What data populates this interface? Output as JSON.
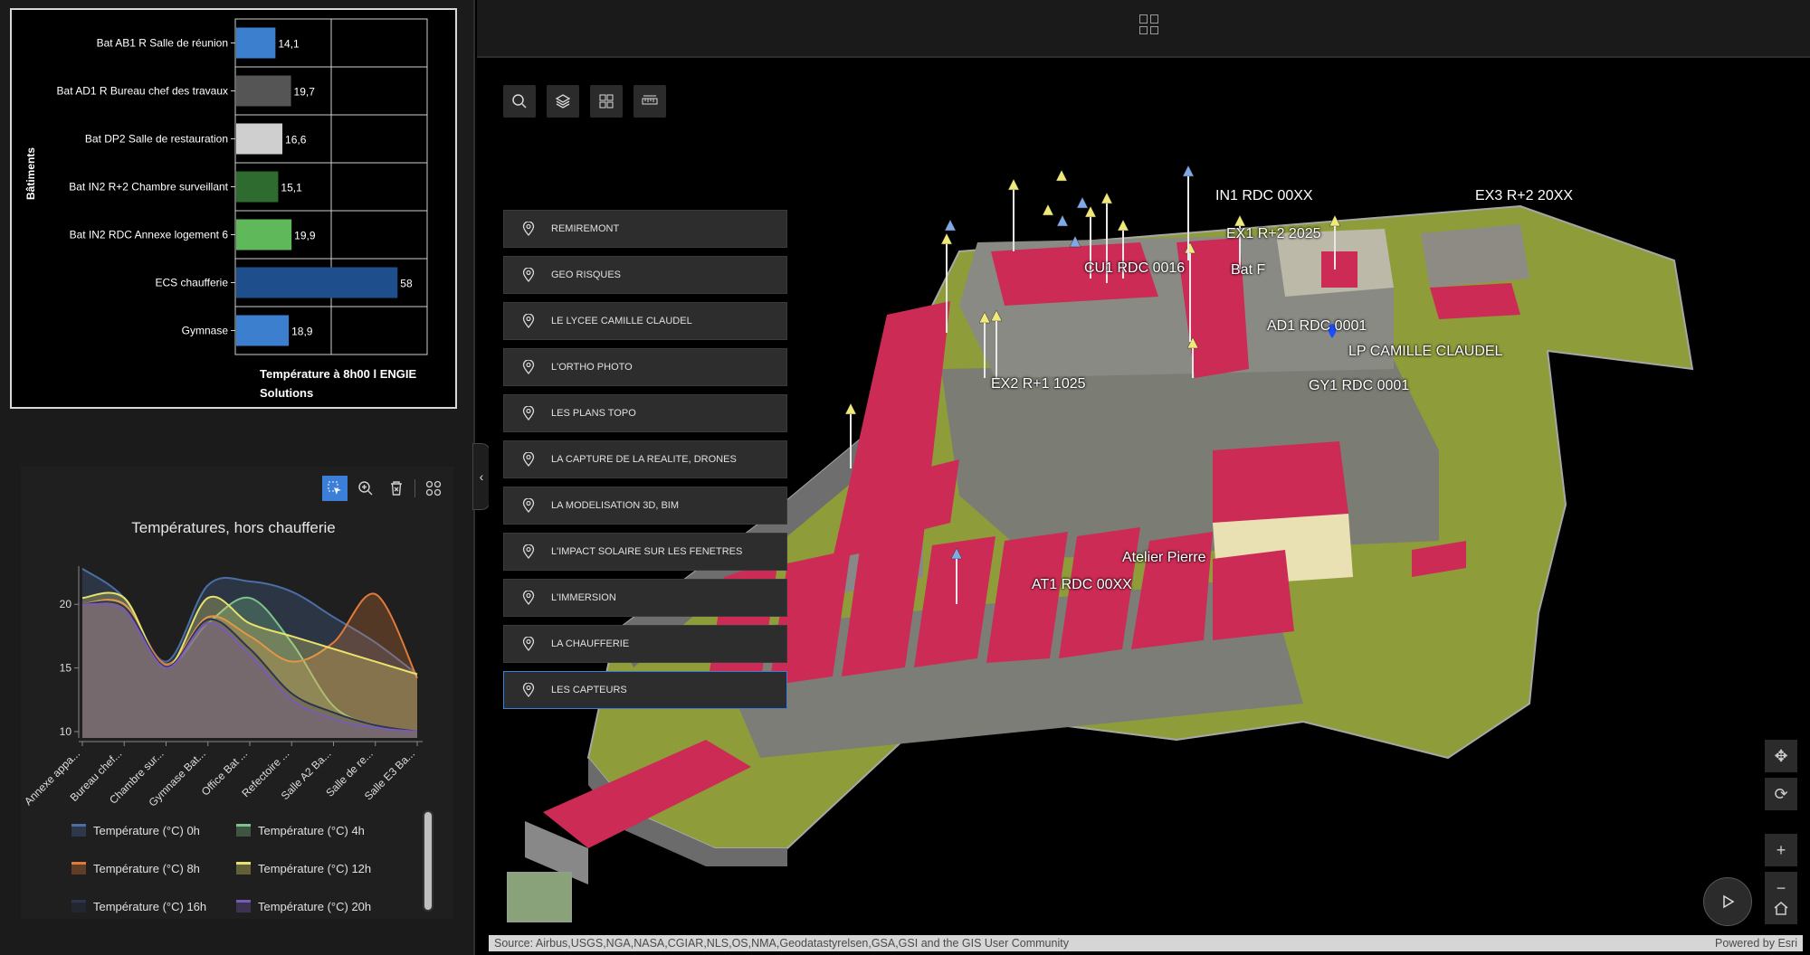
{
  "bar_chart": {
    "chart_data": {
      "type": "bar",
      "orientation": "horizontal",
      "categories": [
        "Bat AB1 R Salle de réunion",
        "Bat AD1 R Bureau chef des travaux",
        "Bat DP2 Salle de restauration",
        "Bat IN2 R+2 Chambre surveillant",
        "Bat IN2 RDC Annexe logement 6",
        "ECS chaufferie",
        "Gymnase"
      ],
      "values": [
        14.1,
        19.7,
        16.6,
        15.1,
        19.9,
        58,
        18.9
      ],
      "value_labels": [
        "14,1",
        "19,7",
        "16,6",
        "15,1",
        "19,9",
        "58",
        "18,9"
      ],
      "colors": [
        "#3d7fcf",
        "#555555",
        "#cfcfcf",
        "#2e6b2e",
        "#5fb85a",
        "#1f4e8c",
        "#3d7fcf"
      ],
      "xlabel": "Température à 8h00 l ENGIE Solutions",
      "ylabel": "Bâtiments",
      "xlim": [
        0,
        100
      ],
      "grid": true
    }
  },
  "line_chart": {
    "title": "Températures, hors chaufferie",
    "toolbar": [
      "select-icon",
      "zoom-icon",
      "clear-selection-icon",
      "grid-icon"
    ],
    "chart_data": {
      "type": "area",
      "categories": [
        "Annexe appa...",
        "Bureau chef...",
        "Chambre sur...",
        "Gymnase Bat...",
        "Office Bat ...",
        "Refectoire ...",
        "Salle A2 Ba...",
        "Salle de re...",
        "Salle E3 Ba..."
      ],
      "ylim": [
        9.5,
        23
      ],
      "yticks": [
        10,
        15,
        20
      ],
      "series": [
        {
          "name": "Température (°C) 0h",
          "color": "#4a6fa5",
          "values": [
            22.8,
            20.5,
            15.5,
            21.5,
            21.8,
            21.0,
            19.0,
            17.0,
            14.5
          ]
        },
        {
          "name": "Température (°C) 4h",
          "color": "#7fc28a",
          "values": [
            20.0,
            20.0,
            15.2,
            18.5,
            20.5,
            17.0,
            12.0,
            10.5,
            10.0
          ]
        },
        {
          "name": "Température (°C) 8h",
          "color": "#e07b39",
          "values": [
            20.0,
            20.0,
            15.3,
            19.0,
            17.5,
            15.5,
            17.0,
            20.8,
            14.2
          ]
        },
        {
          "name": "Température (°C) 12h",
          "color": "#e8e26a",
          "values": [
            20.5,
            20.5,
            15.0,
            20.5,
            18.5,
            17.5,
            16.5,
            15.5,
            14.5
          ]
        },
        {
          "name": "Température (°C) 16h",
          "color": "#2b3550",
          "values": [
            20.0,
            19.8,
            15.1,
            18.8,
            16.5,
            13.0,
            11.5,
            10.5,
            10.0
          ]
        },
        {
          "name": "Température (°C) 20h",
          "color": "#7a5ab5",
          "values": [
            20.0,
            19.5,
            15.0,
            18.5,
            16.0,
            12.5,
            11.0,
            10.3,
            10.0
          ]
        }
      ]
    }
  },
  "scene": {
    "bookmarks": [
      "REMIREMONT",
      "GEO RISQUES",
      "LE LYCEE CAMILLE CLAUDEL",
      "L'ORTHO PHOTO",
      "LES PLANS TOPO",
      "LA CAPTURE DE LA REALITE, DRONES",
      "LA MODELISATION 3D, BIM",
      "L'IMPACT SOLAIRE SUR LES FENETRES",
      "L'IMMERSION",
      "LA CHAUFFERIE",
      "LES CAPTEURS"
    ],
    "active_bookmark": "LES CAPTEURS",
    "labels": {
      "in1": "IN1 RDC 00XX",
      "ex3": "EX3 R+2 20XX",
      "ex1": "EX1 R+2 2025",
      "cu1": "CU1 RDC 0016",
      "batf": "Bat F",
      "ad1": "AD1 RDC 0001",
      "lp": "LP CAMILLE CLAUDEL",
      "gy1": "GY1 RDC 0001",
      "ex2": "EX2 R+1 1025",
      "atelier": "Atelier Pierre",
      "at1": "AT1 RDC 00XX"
    },
    "attribution_left": "Source: Airbus,USGS,NGA,NASA,CGIAR,NLS,OS,NMA,Geodatastyrelsen,GSA,GSI and the GIS User Community",
    "attribution_right": "Powered by Esri"
  }
}
